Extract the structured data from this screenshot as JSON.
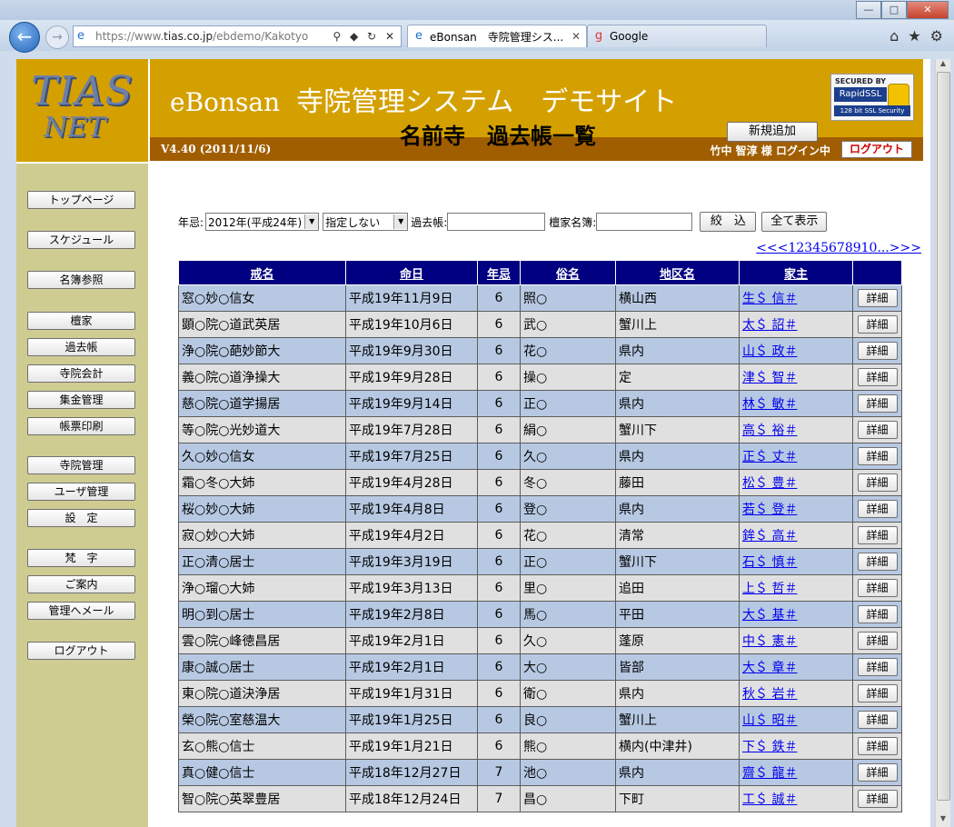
{
  "browser": {
    "url": "https://www.tias.co.jp/ebdemo/Kakotyo",
    "url_gray": "https://www.",
    "url_host": "tias.co.jp",
    "url_path": "/ebdemo/Kakotyo",
    "tabs": [
      {
        "label": "eBonsan　寺院管理シス..."
      },
      {
        "label": "Google"
      }
    ]
  },
  "header": {
    "logo_line1": "TIAS",
    "logo_line2": "NET",
    "title_en": "eBonsan",
    "title_jp": "寺院管理システム　デモサイト",
    "ssl_top": "SECURED BY",
    "ssl_brand": "RapidSSL",
    "ssl_bottom": "128 bit SSL Security",
    "version": "V4.40 (2011/11/6)",
    "user": "竹中 智淳 様  ログイン中",
    "logout": "ログアウト"
  },
  "sidebar": [
    {
      "label": "トップページ"
    },
    {
      "label": "スケジュール"
    },
    {
      "label": "名簿参照"
    },
    {
      "label": "檀家"
    },
    {
      "label": "過去帳"
    },
    {
      "label": "寺院会計"
    },
    {
      "label": "集金管理"
    },
    {
      "label": "帳票印刷"
    },
    {
      "label": "寺院管理"
    },
    {
      "label": "ユーザ管理"
    },
    {
      "label": "設　定"
    },
    {
      "label": "梵　字"
    },
    {
      "label": "ご案内"
    },
    {
      "label": "管理へメール"
    },
    {
      "label": "ログアウト"
    }
  ],
  "main": {
    "title": "名前寺　過去帳一覧",
    "new_button": "新規追加",
    "filter": {
      "nenki_label": "年忌:",
      "year_value": "2012年(平成24年)",
      "spec_value": "指定しない",
      "kakocho_label": "過去帳:",
      "danka_label": "檀家名簿:",
      "narrow_button": "絞　込",
      "show_all_button": "全て表示"
    },
    "pager": "<<<12345678910...>>>",
    "columns": [
      "戒名",
      "命日",
      "年忌",
      "俗名",
      "地区名",
      "家主",
      ""
    ],
    "detail_label": "詳細",
    "rows": [
      {
        "kaimyo": "窓○妙○信女",
        "meinichi": "平成19年11月9日",
        "nenki": "6",
        "zokumyo": "照○",
        "chiku": "横山西",
        "yanushi": "生＄ 信＃"
      },
      {
        "kaimyo": "顕○院○道武英居",
        "meinichi": "平成19年10月6日",
        "nenki": "6",
        "zokumyo": "武○",
        "chiku": "蟹川上",
        "yanushi": "太＄ 詔＃"
      },
      {
        "kaimyo": "浄○院○葩妙節大",
        "meinichi": "平成19年9月30日",
        "nenki": "6",
        "zokumyo": "花○",
        "chiku": "県内",
        "yanushi": "山＄ 政＃"
      },
      {
        "kaimyo": "義○院○道浄操大",
        "meinichi": "平成19年9月28日",
        "nenki": "6",
        "zokumyo": "操○",
        "chiku": "定",
        "yanushi": "津＄ 智＃"
      },
      {
        "kaimyo": "慈○院○道学揚居",
        "meinichi": "平成19年9月14日",
        "nenki": "6",
        "zokumyo": "正○",
        "chiku": "県内",
        "yanushi": "林＄ 敏＃"
      },
      {
        "kaimyo": "等○院○光妙道大",
        "meinichi": "平成19年7月28日",
        "nenki": "6",
        "zokumyo": "絹○",
        "chiku": "蟹川下",
        "yanushi": "高＄ 裕＃"
      },
      {
        "kaimyo": "久○妙○信女",
        "meinichi": "平成19年7月25日",
        "nenki": "6",
        "zokumyo": "久○",
        "chiku": "県内",
        "yanushi": "正＄ 丈＃"
      },
      {
        "kaimyo": "霜○冬○大姉",
        "meinichi": "平成19年4月28日",
        "nenki": "6",
        "zokumyo": "冬○",
        "chiku": "藤田",
        "yanushi": "松＄ 豊＃"
      },
      {
        "kaimyo": "桜○妙○大姉",
        "meinichi": "平成19年4月8日",
        "nenki": "6",
        "zokumyo": "登○",
        "chiku": "県内",
        "yanushi": "若＄ 登＃"
      },
      {
        "kaimyo": "寂○妙○大姉",
        "meinichi": "平成19年4月2日",
        "nenki": "6",
        "zokumyo": "花○",
        "chiku": "清常",
        "yanushi": "鉾＄ 高＃"
      },
      {
        "kaimyo": "正○清○居士",
        "meinichi": "平成19年3月19日",
        "nenki": "6",
        "zokumyo": "正○",
        "chiku": "蟹川下",
        "yanushi": "石＄ 慎＃"
      },
      {
        "kaimyo": "浄○瑠○大姉",
        "meinichi": "平成19年3月13日",
        "nenki": "6",
        "zokumyo": "里○",
        "chiku": "追田",
        "yanushi": "上＄ 哲＃"
      },
      {
        "kaimyo": "明○到○居士",
        "meinichi": "平成19年2月8日",
        "nenki": "6",
        "zokumyo": "馬○",
        "chiku": "平田",
        "yanushi": "大＄ 基＃"
      },
      {
        "kaimyo": "雲○院○峰徳昌居",
        "meinichi": "平成19年2月1日",
        "nenki": "6",
        "zokumyo": "久○",
        "chiku": "蓬原",
        "yanushi": "中＄ 憲＃"
      },
      {
        "kaimyo": "康○誠○居士",
        "meinichi": "平成19年2月1日",
        "nenki": "6",
        "zokumyo": "大○",
        "chiku": "皆部",
        "yanushi": "大＄ 章＃"
      },
      {
        "kaimyo": "東○院○道決浄居",
        "meinichi": "平成19年1月31日",
        "nenki": "6",
        "zokumyo": "衛○",
        "chiku": "県内",
        "yanushi": "秋＄ 岩＃"
      },
      {
        "kaimyo": "榮○院○室慈温大",
        "meinichi": "平成19年1月25日",
        "nenki": "6",
        "zokumyo": "良○",
        "chiku": "蟹川上",
        "yanushi": "山＄ 昭＃"
      },
      {
        "kaimyo": "玄○熊○信士",
        "meinichi": "平成19年1月21日",
        "nenki": "6",
        "zokumyo": "熊○",
        "chiku": "横内(中津井)",
        "yanushi": "下＄ 鉄＃"
      },
      {
        "kaimyo": "真○健○信士",
        "meinichi": "平成18年12月27日",
        "nenki": "7",
        "zokumyo": "池○",
        "chiku": "県内",
        "yanushi": "齋＄ 龍＃"
      },
      {
        "kaimyo": "智○院○英翠豊居",
        "meinichi": "平成18年12月24日",
        "nenki": "7",
        "zokumyo": "昌○",
        "chiku": "下町",
        "yanushi": "工＄ 誠＃"
      }
    ]
  }
}
